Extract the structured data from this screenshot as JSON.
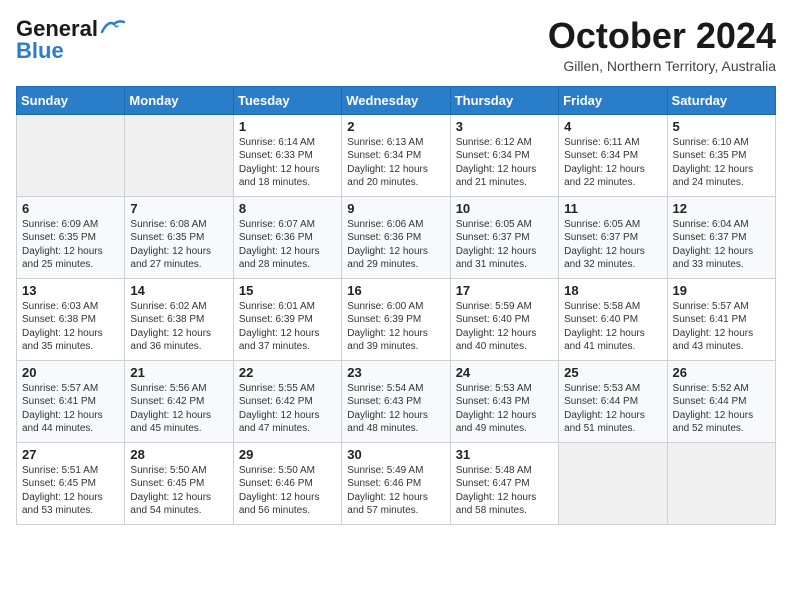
{
  "header": {
    "logo_general": "General",
    "logo_blue": "Blue",
    "month_title": "October 2024",
    "subtitle": "Gillen, Northern Territory, Australia"
  },
  "days_of_week": [
    "Sunday",
    "Monday",
    "Tuesday",
    "Wednesday",
    "Thursday",
    "Friday",
    "Saturday"
  ],
  "weeks": [
    [
      {
        "day": "",
        "sunrise": "",
        "sunset": "",
        "daylight": ""
      },
      {
        "day": "",
        "sunrise": "",
        "sunset": "",
        "daylight": ""
      },
      {
        "day": "1",
        "sunrise": "Sunrise: 6:14 AM",
        "sunset": "Sunset: 6:33 PM",
        "daylight": "Daylight: 12 hours and 18 minutes."
      },
      {
        "day": "2",
        "sunrise": "Sunrise: 6:13 AM",
        "sunset": "Sunset: 6:34 PM",
        "daylight": "Daylight: 12 hours and 20 minutes."
      },
      {
        "day": "3",
        "sunrise": "Sunrise: 6:12 AM",
        "sunset": "Sunset: 6:34 PM",
        "daylight": "Daylight: 12 hours and 21 minutes."
      },
      {
        "day": "4",
        "sunrise": "Sunrise: 6:11 AM",
        "sunset": "Sunset: 6:34 PM",
        "daylight": "Daylight: 12 hours and 22 minutes."
      },
      {
        "day": "5",
        "sunrise": "Sunrise: 6:10 AM",
        "sunset": "Sunset: 6:35 PM",
        "daylight": "Daylight: 12 hours and 24 minutes."
      }
    ],
    [
      {
        "day": "6",
        "sunrise": "Sunrise: 6:09 AM",
        "sunset": "Sunset: 6:35 PM",
        "daylight": "Daylight: 12 hours and 25 minutes."
      },
      {
        "day": "7",
        "sunrise": "Sunrise: 6:08 AM",
        "sunset": "Sunset: 6:35 PM",
        "daylight": "Daylight: 12 hours and 27 minutes."
      },
      {
        "day": "8",
        "sunrise": "Sunrise: 6:07 AM",
        "sunset": "Sunset: 6:36 PM",
        "daylight": "Daylight: 12 hours and 28 minutes."
      },
      {
        "day": "9",
        "sunrise": "Sunrise: 6:06 AM",
        "sunset": "Sunset: 6:36 PM",
        "daylight": "Daylight: 12 hours and 29 minutes."
      },
      {
        "day": "10",
        "sunrise": "Sunrise: 6:05 AM",
        "sunset": "Sunset: 6:37 PM",
        "daylight": "Daylight: 12 hours and 31 minutes."
      },
      {
        "day": "11",
        "sunrise": "Sunrise: 6:05 AM",
        "sunset": "Sunset: 6:37 PM",
        "daylight": "Daylight: 12 hours and 32 minutes."
      },
      {
        "day": "12",
        "sunrise": "Sunrise: 6:04 AM",
        "sunset": "Sunset: 6:37 PM",
        "daylight": "Daylight: 12 hours and 33 minutes."
      }
    ],
    [
      {
        "day": "13",
        "sunrise": "Sunrise: 6:03 AM",
        "sunset": "Sunset: 6:38 PM",
        "daylight": "Daylight: 12 hours and 35 minutes."
      },
      {
        "day": "14",
        "sunrise": "Sunrise: 6:02 AM",
        "sunset": "Sunset: 6:38 PM",
        "daylight": "Daylight: 12 hours and 36 minutes."
      },
      {
        "day": "15",
        "sunrise": "Sunrise: 6:01 AM",
        "sunset": "Sunset: 6:39 PM",
        "daylight": "Daylight: 12 hours and 37 minutes."
      },
      {
        "day": "16",
        "sunrise": "Sunrise: 6:00 AM",
        "sunset": "Sunset: 6:39 PM",
        "daylight": "Daylight: 12 hours and 39 minutes."
      },
      {
        "day": "17",
        "sunrise": "Sunrise: 5:59 AM",
        "sunset": "Sunset: 6:40 PM",
        "daylight": "Daylight: 12 hours and 40 minutes."
      },
      {
        "day": "18",
        "sunrise": "Sunrise: 5:58 AM",
        "sunset": "Sunset: 6:40 PM",
        "daylight": "Daylight: 12 hours and 41 minutes."
      },
      {
        "day": "19",
        "sunrise": "Sunrise: 5:57 AM",
        "sunset": "Sunset: 6:41 PM",
        "daylight": "Daylight: 12 hours and 43 minutes."
      }
    ],
    [
      {
        "day": "20",
        "sunrise": "Sunrise: 5:57 AM",
        "sunset": "Sunset: 6:41 PM",
        "daylight": "Daylight: 12 hours and 44 minutes."
      },
      {
        "day": "21",
        "sunrise": "Sunrise: 5:56 AM",
        "sunset": "Sunset: 6:42 PM",
        "daylight": "Daylight: 12 hours and 45 minutes."
      },
      {
        "day": "22",
        "sunrise": "Sunrise: 5:55 AM",
        "sunset": "Sunset: 6:42 PM",
        "daylight": "Daylight: 12 hours and 47 minutes."
      },
      {
        "day": "23",
        "sunrise": "Sunrise: 5:54 AM",
        "sunset": "Sunset: 6:43 PM",
        "daylight": "Daylight: 12 hours and 48 minutes."
      },
      {
        "day": "24",
        "sunrise": "Sunrise: 5:53 AM",
        "sunset": "Sunset: 6:43 PM",
        "daylight": "Daylight: 12 hours and 49 minutes."
      },
      {
        "day": "25",
        "sunrise": "Sunrise: 5:53 AM",
        "sunset": "Sunset: 6:44 PM",
        "daylight": "Daylight: 12 hours and 51 minutes."
      },
      {
        "day": "26",
        "sunrise": "Sunrise: 5:52 AM",
        "sunset": "Sunset: 6:44 PM",
        "daylight": "Daylight: 12 hours and 52 minutes."
      }
    ],
    [
      {
        "day": "27",
        "sunrise": "Sunrise: 5:51 AM",
        "sunset": "Sunset: 6:45 PM",
        "daylight": "Daylight: 12 hours and 53 minutes."
      },
      {
        "day": "28",
        "sunrise": "Sunrise: 5:50 AM",
        "sunset": "Sunset: 6:45 PM",
        "daylight": "Daylight: 12 hours and 54 minutes."
      },
      {
        "day": "29",
        "sunrise": "Sunrise: 5:50 AM",
        "sunset": "Sunset: 6:46 PM",
        "daylight": "Daylight: 12 hours and 56 minutes."
      },
      {
        "day": "30",
        "sunrise": "Sunrise: 5:49 AM",
        "sunset": "Sunset: 6:46 PM",
        "daylight": "Daylight: 12 hours and 57 minutes."
      },
      {
        "day": "31",
        "sunrise": "Sunrise: 5:48 AM",
        "sunset": "Sunset: 6:47 PM",
        "daylight": "Daylight: 12 hours and 58 minutes."
      },
      {
        "day": "",
        "sunrise": "",
        "sunset": "",
        "daylight": ""
      },
      {
        "day": "",
        "sunrise": "",
        "sunset": "",
        "daylight": ""
      }
    ]
  ]
}
